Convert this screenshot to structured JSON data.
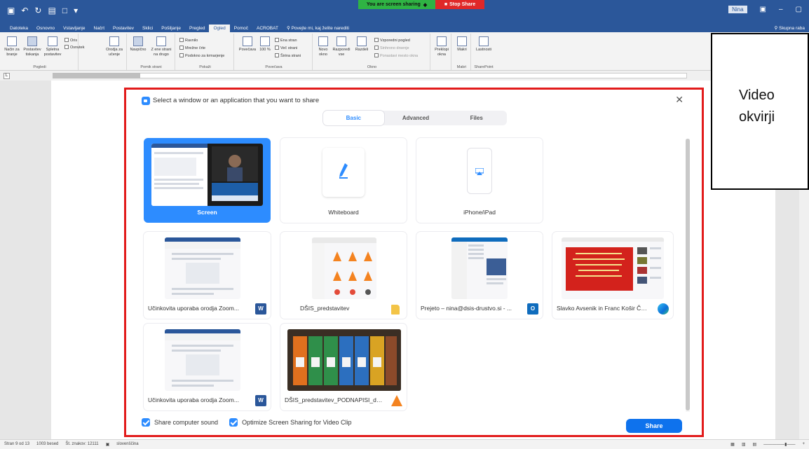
{
  "sharing_banner": {
    "status": "You are screen sharing",
    "stop": "Stop Share"
  },
  "titlebar": {
    "user": "Nina"
  },
  "ribbon_tabs": [
    "Datoteka",
    "Osnovno",
    "Vstavljanje",
    "Načrt",
    "Postavitev",
    "Sklici",
    "Pošiljanje",
    "Pregled",
    "Ogled",
    "Pomoč",
    "ACROBAT"
  ],
  "ribbon_active_tab": "Ogled",
  "ribbon_search": "Povejte mi, kaj želite narediti",
  "ribbon_share": "Skupna raba",
  "ribbon": {
    "groups": [
      "Pogledi",
      "Pomik strani",
      "Pokaži",
      "Povečava",
      "Okno",
      "Makri",
      "SharePoint"
    ],
    "items": {
      "nacin_branja": "Način za branje",
      "postavitev_tiskanja": "Postavitev tiskanja",
      "spletna_postavitev": "Spletna postavitev",
      "oris": "Oris",
      "osnutek": "Osnutek",
      "orodja_ucenje": "Orodja za učenje",
      "navpicno": "Navpično",
      "z_ene_strani": "Z ene strani na drugo",
      "ravnilo": "Ravnilo",
      "mrezne_crte": "Mrežne črte",
      "podokno": "Podokno za krmarjenje",
      "povecava": "Povečava",
      "sto": "100 %",
      "ena_stran": "Ena stran",
      "vec_strani": "Več strani",
      "sirina_strani": "Širina strani",
      "novo_okno": "Novo okno",
      "razporedi": "Razporedi vse",
      "razdeli": "Razdeli",
      "vzporedni": "Vzporedni pogled",
      "sinhrono": "Sinhrono drsenje",
      "ponastavi": "Ponastavi mesto okna",
      "preklopi": "Preklopi okna",
      "makri": "Makri",
      "lastnosti": "Lastnosti"
    }
  },
  "overlay": {
    "text": "Video okvirji"
  },
  "statusbar": {
    "left": [
      "Stran 9 od 13",
      "1003 besed",
      "Št. znakov: 12111",
      "slovenščina"
    ],
    "zoom": "+"
  },
  "dialog": {
    "title": "Select a window or an application that you want to share",
    "tabs": [
      "Basic",
      "Advanced",
      "Files"
    ],
    "active_tab": "Basic",
    "tiles": [
      {
        "label": "Screen",
        "kind": "screen",
        "selected": true
      },
      {
        "label": "Whiteboard",
        "kind": "whiteboard"
      },
      {
        "label": "iPhone/iPad",
        "kind": "iphone"
      },
      {
        "label": "Učinkovita uporaba orodja Zoom...",
        "kind": "word",
        "badge": "W"
      },
      {
        "label": "DŠIS_predstavitev",
        "kind": "folder",
        "badge": ""
      },
      {
        "label": "Prejeto – nina@dsis-drustvo.si - ...",
        "kind": "outlook",
        "badge": "O"
      },
      {
        "label": "Slavko Avsenik in Franc Košir Če v...",
        "kind": "edge",
        "badge": ""
      },
      {
        "label": "Učinkovita uporaba orodja Zoom...",
        "kind": "word",
        "badge": "W"
      },
      {
        "label": "DŠIS_predstavitev_PODNAPISI_da...",
        "kind": "vlc",
        "badge": ""
      }
    ],
    "checkbox_sound": "Share computer sound",
    "checkbox_optimize": "Optimize Screen Sharing for Video Clip",
    "share_button": "Share"
  },
  "colors": {
    "word_blue": "#2b579a",
    "zoom_blue": "#2d8cff",
    "highlight_red": "#e21b1b"
  }
}
